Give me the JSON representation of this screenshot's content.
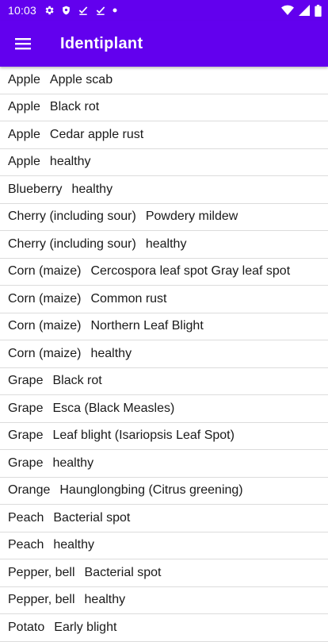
{
  "status_bar": {
    "time": "10:03",
    "left_icons": [
      "gear-icon",
      "shield-icon",
      "check-icon",
      "check-icon",
      "dot-icon"
    ],
    "right_icons": [
      "wifi-icon",
      "signal-icon",
      "battery-icon"
    ]
  },
  "app_bar": {
    "title": "Identiplant",
    "menu_icon": "hamburger-menu-icon",
    "background": "#6200ee"
  },
  "items": [
    {
      "plant": "Apple",
      "disease": "Apple scab"
    },
    {
      "plant": "Apple",
      "disease": "Black rot"
    },
    {
      "plant": "Apple",
      "disease": "Cedar apple rust"
    },
    {
      "plant": "Apple",
      "disease": "healthy"
    },
    {
      "plant": "Blueberry",
      "disease": "healthy"
    },
    {
      "plant": "Cherry (including sour)",
      "disease": "Powdery mildew"
    },
    {
      "plant": "Cherry (including sour)",
      "disease": "healthy"
    },
    {
      "plant": "Corn (maize)",
      "disease": "Cercospora leaf spot Gray leaf spot"
    },
    {
      "plant": "Corn (maize)",
      "disease": "Common rust"
    },
    {
      "plant": "Corn (maize)",
      "disease": "Northern Leaf Blight"
    },
    {
      "plant": "Corn (maize)",
      "disease": "healthy"
    },
    {
      "plant": "Grape",
      "disease": "Black rot"
    },
    {
      "plant": "Grape",
      "disease": "Esca (Black Measles)"
    },
    {
      "plant": "Grape",
      "disease": "Leaf blight (Isariopsis Leaf Spot)"
    },
    {
      "plant": "Grape",
      "disease": "healthy"
    },
    {
      "plant": "Orange",
      "disease": "Haunglongbing (Citrus greening)"
    },
    {
      "plant": "Peach",
      "disease": "Bacterial spot"
    },
    {
      "plant": "Peach",
      "disease": "healthy"
    },
    {
      "plant": "Pepper, bell",
      "disease": "Bacterial spot"
    },
    {
      "plant": "Pepper, bell",
      "disease": "healthy"
    },
    {
      "plant": "Potato",
      "disease": "Early blight"
    }
  ]
}
